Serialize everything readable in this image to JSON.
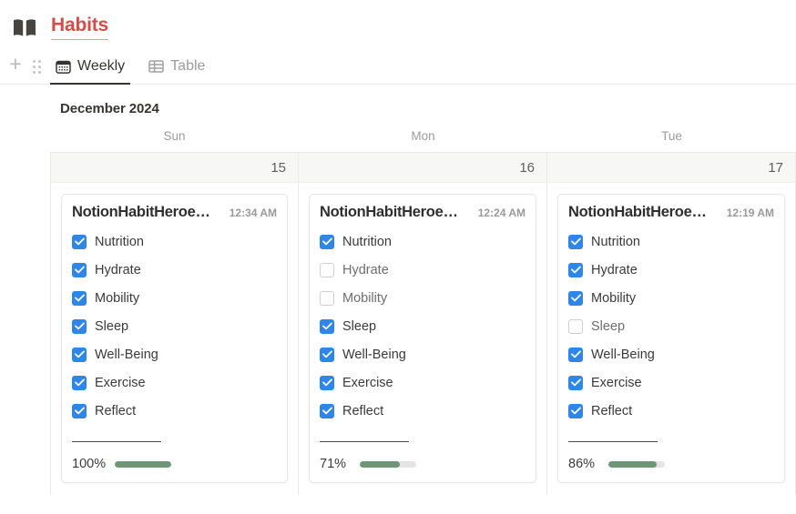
{
  "header": {
    "icon": "open-book-icon",
    "title": "Habits",
    "title_color": "#d44c47"
  },
  "toolbar": {
    "add_label": "+",
    "drag_handle": "drag-handle-icon",
    "tabs": [
      {
        "label": "Weekly",
        "icon": "calendar-icon",
        "active": true
      },
      {
        "label": "Table",
        "icon": "table-icon",
        "active": false
      }
    ]
  },
  "calendar": {
    "month_label": "December 2024",
    "weekdays": [
      "Sun",
      "Mon",
      "Tue"
    ],
    "accent_checked": "#2e87e8",
    "accent_progress": "#6d9676",
    "days": [
      {
        "weekday": "Sun",
        "day_number": "15",
        "card": {
          "title": "NotionHabitHeroe…",
          "time": "12:34 AM",
          "habits": [
            {
              "name": "Nutrition",
              "checked": true
            },
            {
              "name": "Hydrate",
              "checked": true
            },
            {
              "name": "Mobility",
              "checked": true
            },
            {
              "name": "Sleep",
              "checked": true
            },
            {
              "name": "Well-Being",
              "checked": true
            },
            {
              "name": "Exercise",
              "checked": true
            },
            {
              "name": "Reflect",
              "checked": true
            }
          ],
          "percent_label": "100%",
          "percent_value": 100
        }
      },
      {
        "weekday": "Mon",
        "day_number": "16",
        "card": {
          "title": "NotionHabitHeroe…",
          "time": "12:24 AM",
          "habits": [
            {
              "name": "Nutrition",
              "checked": true
            },
            {
              "name": "Hydrate",
              "checked": false
            },
            {
              "name": "Mobility",
              "checked": false
            },
            {
              "name": "Sleep",
              "checked": true
            },
            {
              "name": "Well-Being",
              "checked": true
            },
            {
              "name": "Exercise",
              "checked": true
            },
            {
              "name": "Reflect",
              "checked": true
            }
          ],
          "percent_label": "71%",
          "percent_value": 71
        }
      },
      {
        "weekday": "Tue",
        "day_number": "17",
        "card": {
          "title": "NotionHabitHeroe…",
          "time": "12:19 AM",
          "habits": [
            {
              "name": "Nutrition",
              "checked": true
            },
            {
              "name": "Hydrate",
              "checked": true
            },
            {
              "name": "Mobility",
              "checked": true
            },
            {
              "name": "Sleep",
              "checked": false
            },
            {
              "name": "Well-Being",
              "checked": true
            },
            {
              "name": "Exercise",
              "checked": true
            },
            {
              "name": "Reflect",
              "checked": true
            }
          ],
          "percent_label": "86%",
          "percent_value": 86
        }
      }
    ]
  }
}
